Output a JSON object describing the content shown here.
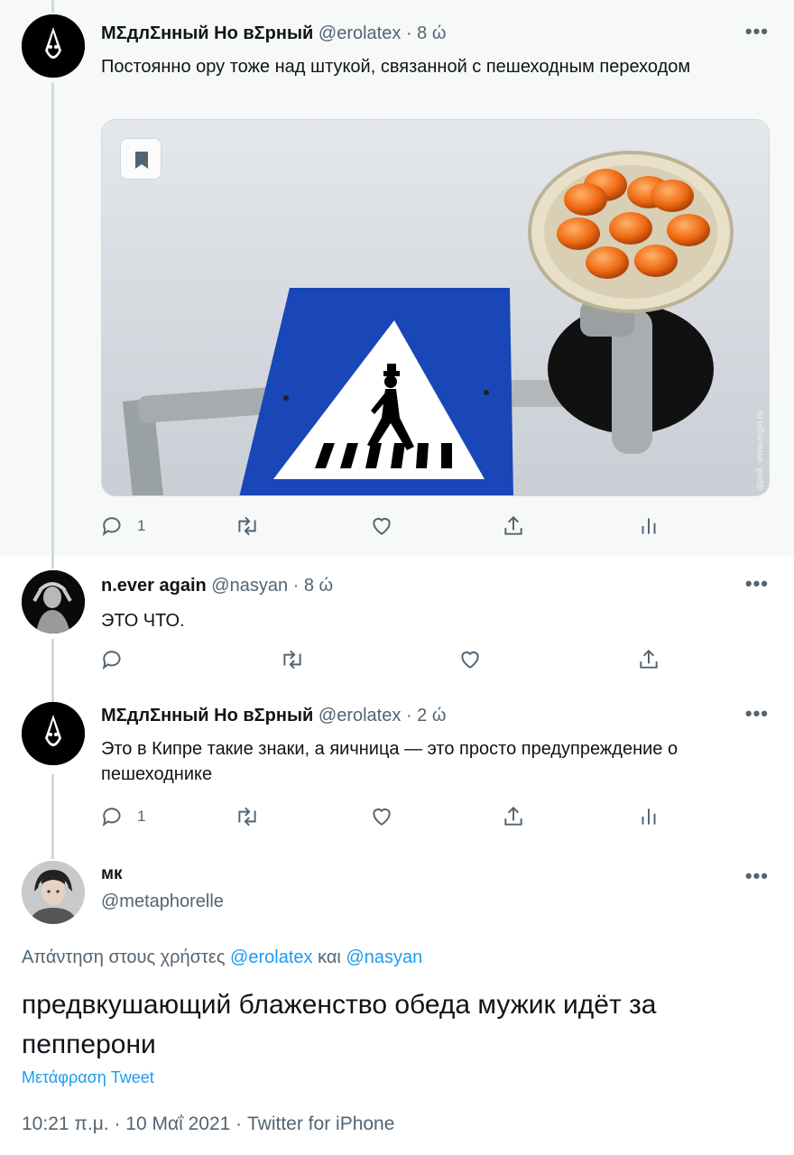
{
  "tweets": [
    {
      "name": "MΣдлΣнный Нo вΣрный",
      "handle": "@erolatex",
      "separator": "·",
      "time": "8 ώ",
      "text": "Постоянно ору тоже над штукой, связанной с пешеходным переходом",
      "media_alt": "Знак пешеходного перехода и оранжевый фонарь",
      "replies": "1"
    },
    {
      "name": "n.ever again",
      "handle": "@nasyan",
      "separator": "·",
      "time": "8 ώ",
      "text": "ЭТО ЧТО.",
      "replies": ""
    },
    {
      "name": "MΣдлΣнный Нo вΣрный",
      "handle": "@erolatex",
      "separator": "·",
      "time": "2 ώ",
      "text": "Это в Кипре такие знаки, а яичница — это просто предупреждение о пешеходнике",
      "replies": "1"
    }
  ],
  "main_tweet": {
    "name": "мк",
    "handle": "@metaphorelle",
    "reply_prefix": "Απάντηση στους χρήστες",
    "reply_user1": "@erolatex",
    "reply_and": "και",
    "reply_user2": "@nasyan",
    "text": "предвкушающий блаженство обеда мужик идёт за пепперони",
    "translate": "Μετάφραση Tweet",
    "meta": "10:21 π.μ. · 10 Μαΐ 2021 · Twitter for iPhone"
  },
  "watermark": "фрий, www.ergin.ru",
  "colors": {
    "accent": "#1d9bf0",
    "secondary_text": "#536471",
    "highlight_bg": "#f7f9f9",
    "thread_line": "#cfd9de"
  },
  "icons": [
    "reply-icon",
    "retweet-icon",
    "like-icon",
    "share-icon",
    "analytics-icon",
    "bookmark-icon",
    "more-icon"
  ]
}
